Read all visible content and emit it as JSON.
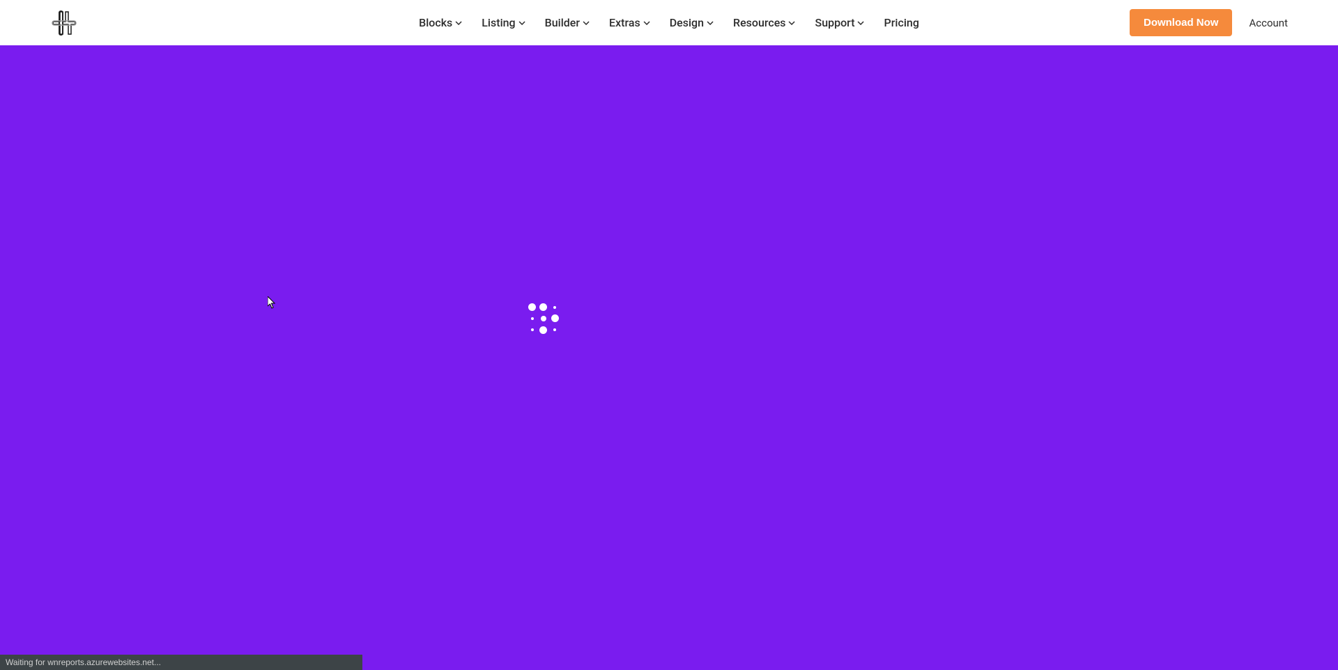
{
  "header": {
    "nav_items": [
      {
        "label": "Blocks",
        "has_dropdown": true
      },
      {
        "label": "Listing",
        "has_dropdown": true
      },
      {
        "label": "Builder",
        "has_dropdown": true
      },
      {
        "label": "Extras",
        "has_dropdown": true
      },
      {
        "label": "Design",
        "has_dropdown": true
      },
      {
        "label": "Resources",
        "has_dropdown": true
      },
      {
        "label": "Support",
        "has_dropdown": true
      },
      {
        "label": "Pricing",
        "has_dropdown": false
      }
    ],
    "download_button": "Download Now",
    "account_link": "Account"
  },
  "status_bar": {
    "text": "Waiting for wnreports.azurewebsites.net..."
  },
  "colors": {
    "primary": "#7a1cef",
    "accent": "#f58a3c",
    "text": "#2d2d2d"
  }
}
